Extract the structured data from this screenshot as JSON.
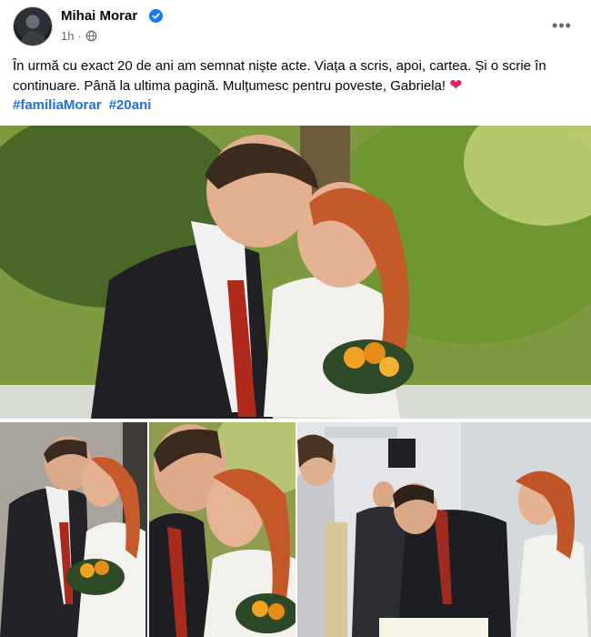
{
  "post": {
    "author": "Mihai Morar",
    "time": "1h",
    "separator": "·",
    "more_label": "•••",
    "caption": "În urmă cu exact 20 de ani am semnat niște acte. Viața a scris, apoi, cartea. Și o scrie în continuare. Până la ultima pagină. Mulțumesc pentru poveste, Gabriela!",
    "heart": "❤",
    "hashtags": [
      "#familiaMorar",
      "#20ani"
    ]
  },
  "icons": {
    "verified": "verified-badge-icon",
    "privacy": "globe-icon",
    "more": "more-options-icon"
  },
  "colors": {
    "link": "#216fdb",
    "verified": "#1877f2",
    "meta": "#65676b",
    "heart": "#e0245e"
  }
}
